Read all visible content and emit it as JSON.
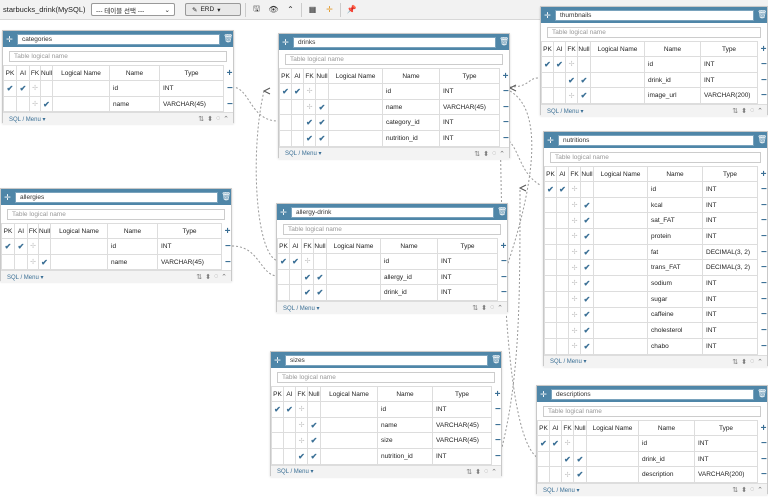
{
  "toolbar": {
    "project": "starbucks_drink(MySQL)",
    "table_select": "--- 테이블 선택 ---",
    "erd": "ERD",
    "icons": [
      "save-icon",
      "eye-icon",
      "chevron-up-icon",
      "grid-icon",
      "move-icon",
      "pin-icon"
    ]
  },
  "common": {
    "logical": "Table logical name",
    "sql_menu": "SQL / Menu",
    "headers": {
      "pk": "PK",
      "ai": "AI",
      "fk": "FK",
      "null": "Null",
      "logical": "Logical Name",
      "name": "Name",
      "type": "Type"
    }
  },
  "tables": {
    "categories": {
      "name": "categories",
      "rows": [
        {
          "name": "id",
          "type": "INT"
        },
        {
          "name": "name",
          "type": "VARCHAR(45)"
        }
      ]
    },
    "drinks": {
      "name": "drinks",
      "rows": [
        {
          "name": "id",
          "type": "INT"
        },
        {
          "name": "name",
          "type": "VARCHAR(45)"
        },
        {
          "name": "category_id",
          "type": "INT"
        },
        {
          "name": "nutrition_id",
          "type": "INT"
        }
      ]
    },
    "thumbnails": {
      "name": "thumbnails",
      "rows": [
        {
          "name": "id",
          "type": "INT"
        },
        {
          "name": "drink_id",
          "type": "INT"
        },
        {
          "name": "image_url",
          "type": "VARCHAR(200)"
        }
      ]
    },
    "nutritions": {
      "name": "nutritions",
      "rows": [
        {
          "name": "id",
          "type": "INT"
        },
        {
          "name": "kcal",
          "type": "INT"
        },
        {
          "name": "sat_FAT",
          "type": "INT"
        },
        {
          "name": "protein",
          "type": "INT"
        },
        {
          "name": "fat",
          "type": "DECIMAL(3, 2)"
        },
        {
          "name": "trans_FAT",
          "type": "DECIMAL(3, 2)"
        },
        {
          "name": "sodium",
          "type": "INT"
        },
        {
          "name": "sugar",
          "type": "INT"
        },
        {
          "name": "caffeine",
          "type": "INT"
        },
        {
          "name": "cholesterol",
          "type": "INT"
        },
        {
          "name": "chabo",
          "type": "INT"
        }
      ]
    },
    "allergies": {
      "name": "allergies",
      "rows": [
        {
          "name": "id",
          "type": "INT"
        },
        {
          "name": "name",
          "type": "VARCHAR(45)"
        }
      ]
    },
    "allergy_drink": {
      "name": "allergy-drink",
      "rows": [
        {
          "name": "id",
          "type": "INT"
        },
        {
          "name": "allergy_id",
          "type": "INT"
        },
        {
          "name": "drink_id",
          "type": "INT"
        }
      ]
    },
    "sizes": {
      "name": "sizes",
      "rows": [
        {
          "name": "id",
          "type": "INT"
        },
        {
          "name": "name",
          "type": "VARCHAR(45)"
        },
        {
          "name": "size",
          "type": "VARCHAR(45)"
        },
        {
          "name": "nutrition_id",
          "type": "INT"
        }
      ]
    },
    "descriptions": {
      "name": "descriptions",
      "rows": [
        {
          "name": "id",
          "type": "INT"
        },
        {
          "name": "drink_id",
          "type": "INT"
        },
        {
          "name": "description",
          "type": "VARCHAR(200)"
        }
      ]
    }
  }
}
